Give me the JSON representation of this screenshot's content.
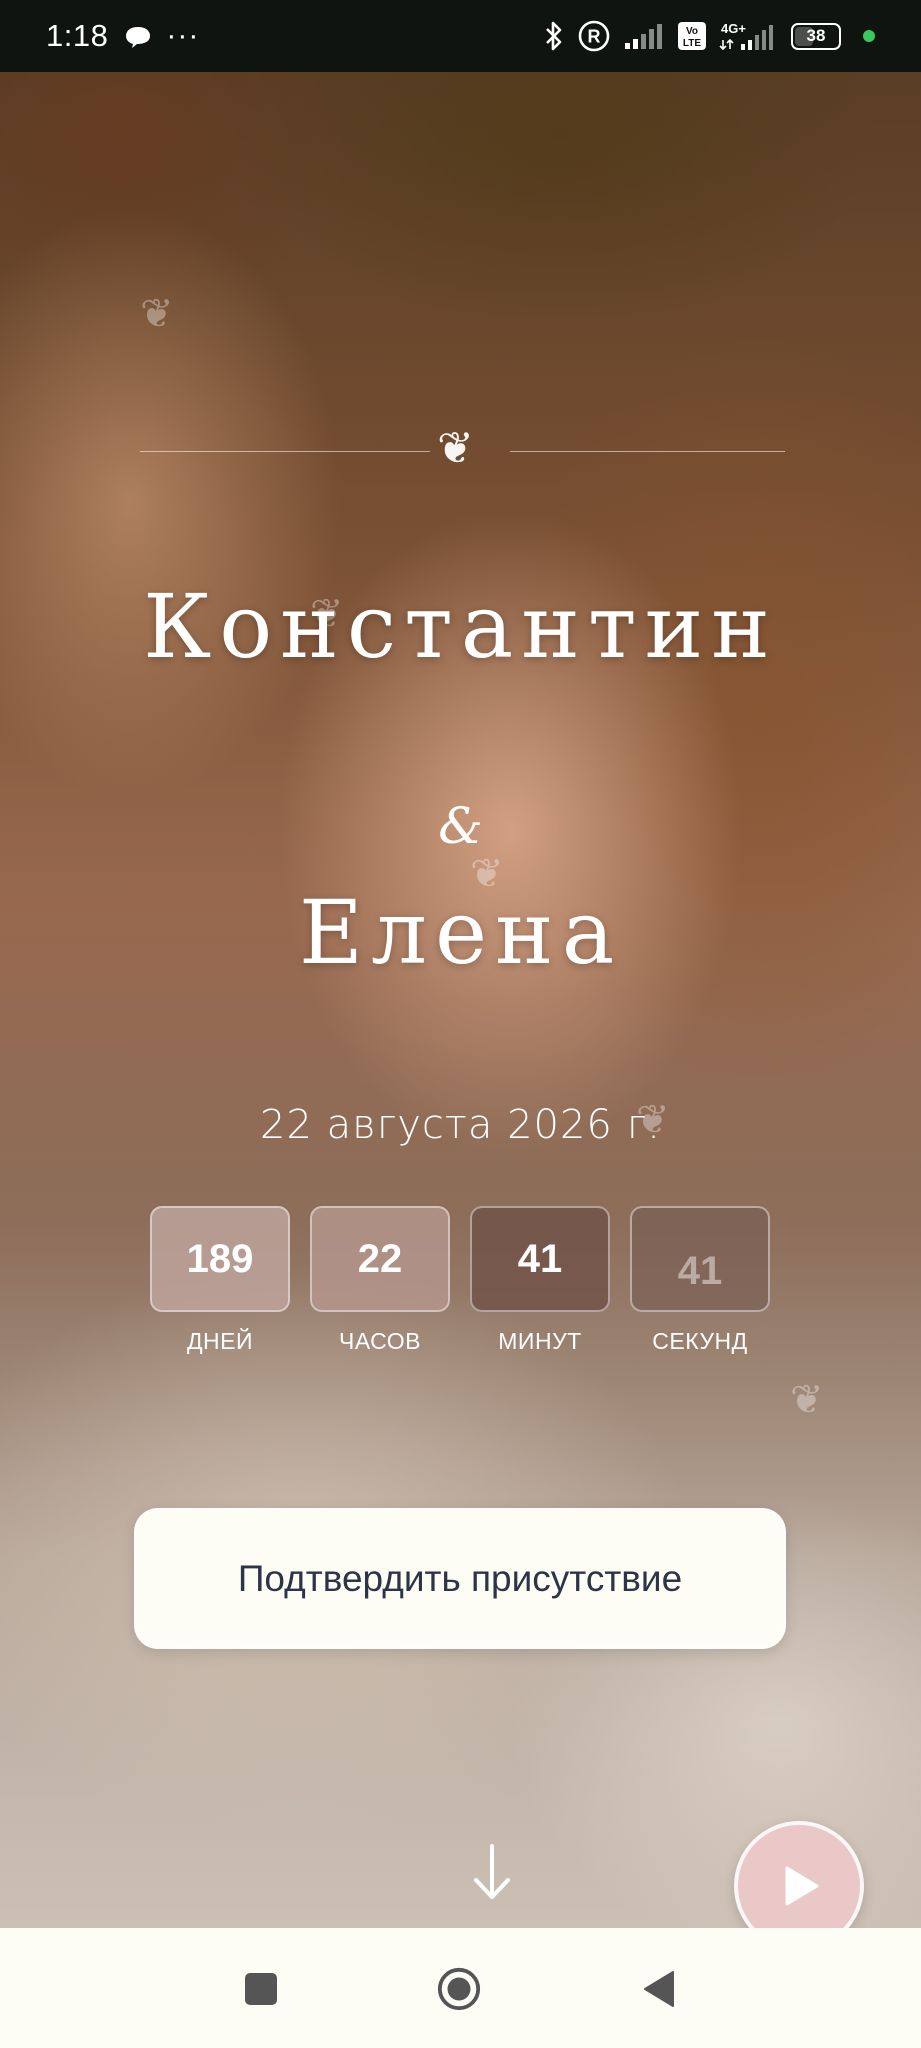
{
  "status_bar": {
    "time": "1:18",
    "dots": "···",
    "battery": "38",
    "network": "4G+",
    "volte": "Vo LTE",
    "icons": [
      "chat-bubble-icon",
      "bluetooth-icon",
      "registered-icon",
      "signal-icon",
      "volte-icon",
      "signal-4g-icon",
      "battery-icon",
      "privacy-dot-icon"
    ]
  },
  "hero": {
    "ornament_icon": "heart-ornament-icon",
    "groom_name": "Константин",
    "ampersand": "&",
    "bride_name": "Елена",
    "date": "22 августа 2026 г."
  },
  "countdown": [
    {
      "value": "189",
      "label": "ДНЕЙ"
    },
    {
      "value": "22",
      "label": "ЧАСОВ"
    },
    {
      "value": "41",
      "label": "МИНУТ"
    },
    {
      "value": "41",
      "label": "СЕКУНД"
    }
  ],
  "rsvp": {
    "label": "Подтвердить присутствие"
  },
  "controls": {
    "scroll_icon": "arrow-down-icon",
    "play_icon": "play-icon"
  },
  "nav_bar": {
    "icons": [
      "recents-square-icon",
      "home-circle-icon",
      "back-triangle-icon"
    ]
  },
  "colors": {
    "status_bg": "#101411",
    "nav_bg": "#fdfcf5",
    "button_bg": "#fdfcf5",
    "button_text": "#2c3446",
    "play_bg": "#eac8c8",
    "privacy_dot": "#37c860"
  }
}
